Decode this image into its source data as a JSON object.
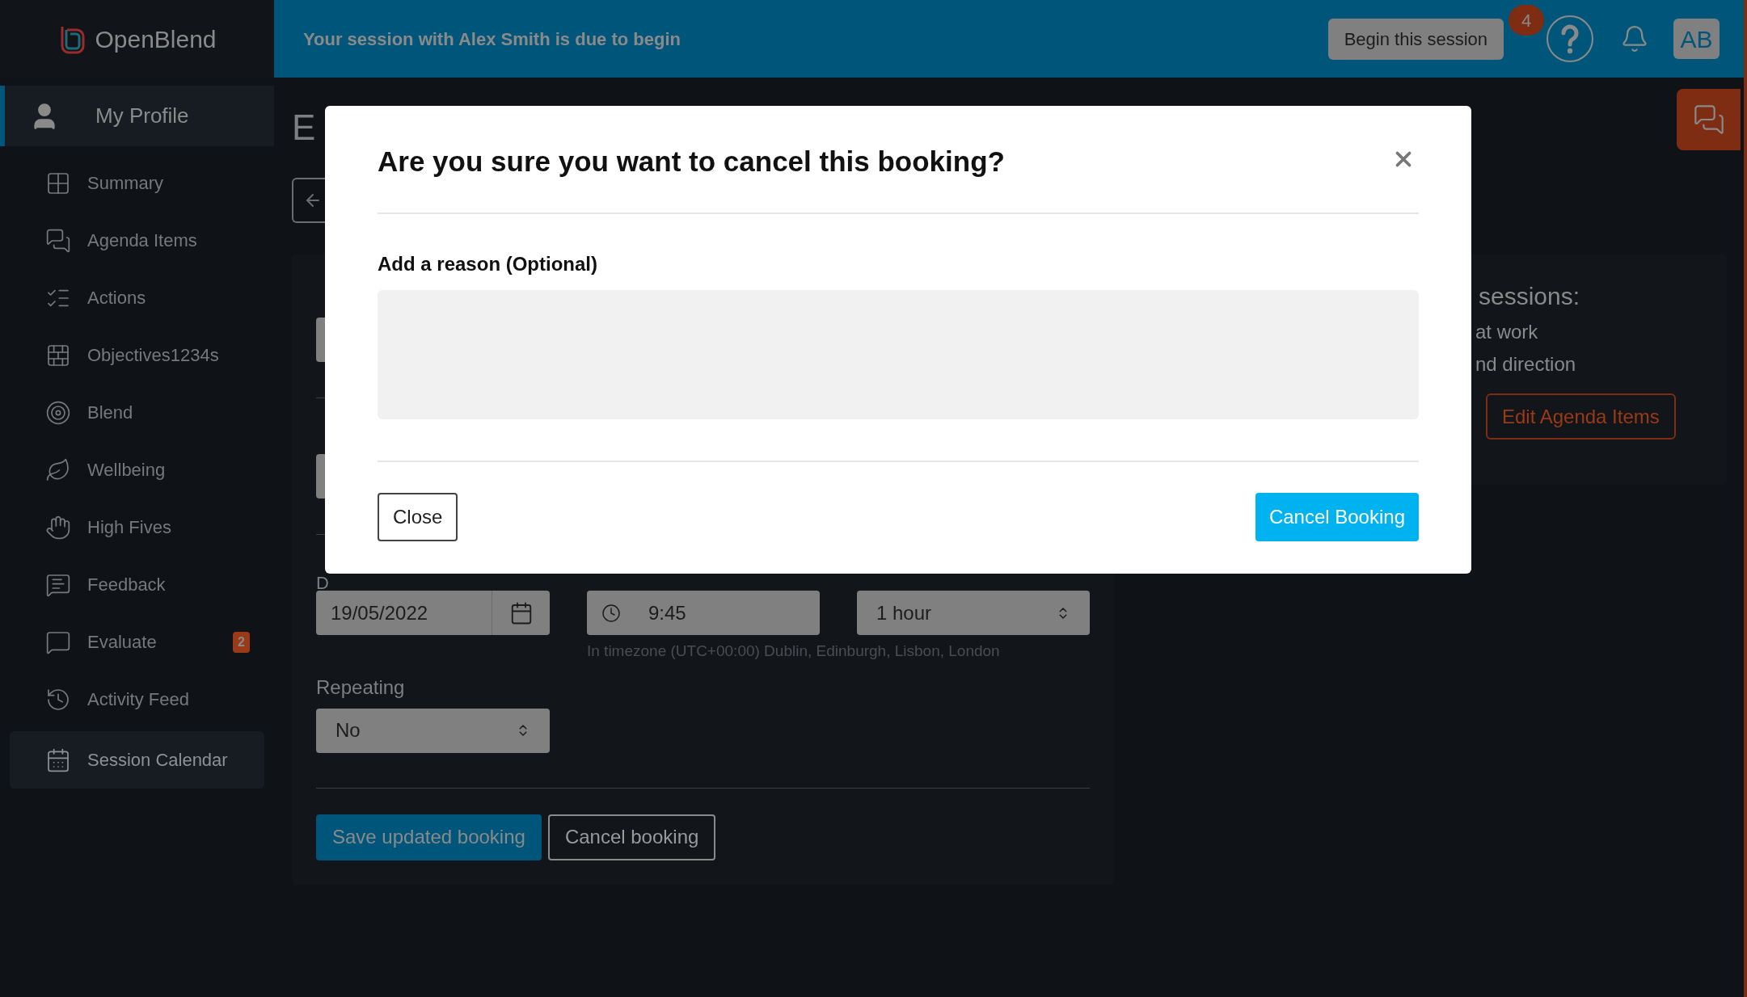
{
  "app": {
    "logo": "OpenBlend"
  },
  "banner": {
    "message": "Your session with Alex Smith is due to begin",
    "button": "Begin this session"
  },
  "header": {
    "help_badge": "4",
    "avatar": "AB"
  },
  "sidebar": {
    "profile": "My Profile",
    "items": [
      {
        "label": "Summary",
        "selected": false
      },
      {
        "label": "Agenda Items",
        "selected": false
      },
      {
        "label": "Actions",
        "selected": false
      },
      {
        "label": "Objectives1234s",
        "selected": false
      },
      {
        "label": "Blend",
        "selected": false
      },
      {
        "label": "Wellbeing",
        "selected": false
      },
      {
        "label": "High Fives",
        "selected": false
      },
      {
        "label": "Feedback",
        "selected": false
      },
      {
        "label": "Evaluate",
        "selected": false,
        "badge": "2"
      },
      {
        "label": "Activity Feed",
        "selected": false
      },
      {
        "label": "Session Calendar",
        "selected": true
      }
    ]
  },
  "page": {
    "heading": "E",
    "labels": [
      "D"
    ],
    "date": "19/05/2022",
    "time": "9:45",
    "duration": "1 hour",
    "timezone": "In timezone (UTC+00:00) Dublin, Edinburgh, Lisbon, London",
    "repeating_label": "Repeating",
    "repeating": "No",
    "buttons": [
      "Save updated booking",
      "Cancel booking"
    ]
  },
  "side_card": {
    "title": "sessions:",
    "lines": [
      "at work",
      "nd direction"
    ],
    "button": "Edit Agenda Items"
  },
  "modal": {
    "title": "Are you sure you want to cancel this booking?",
    "reason_label": "Add a reason (Optional)",
    "close_button": "Close",
    "confirm_button": "Cancel Booking"
  }
}
